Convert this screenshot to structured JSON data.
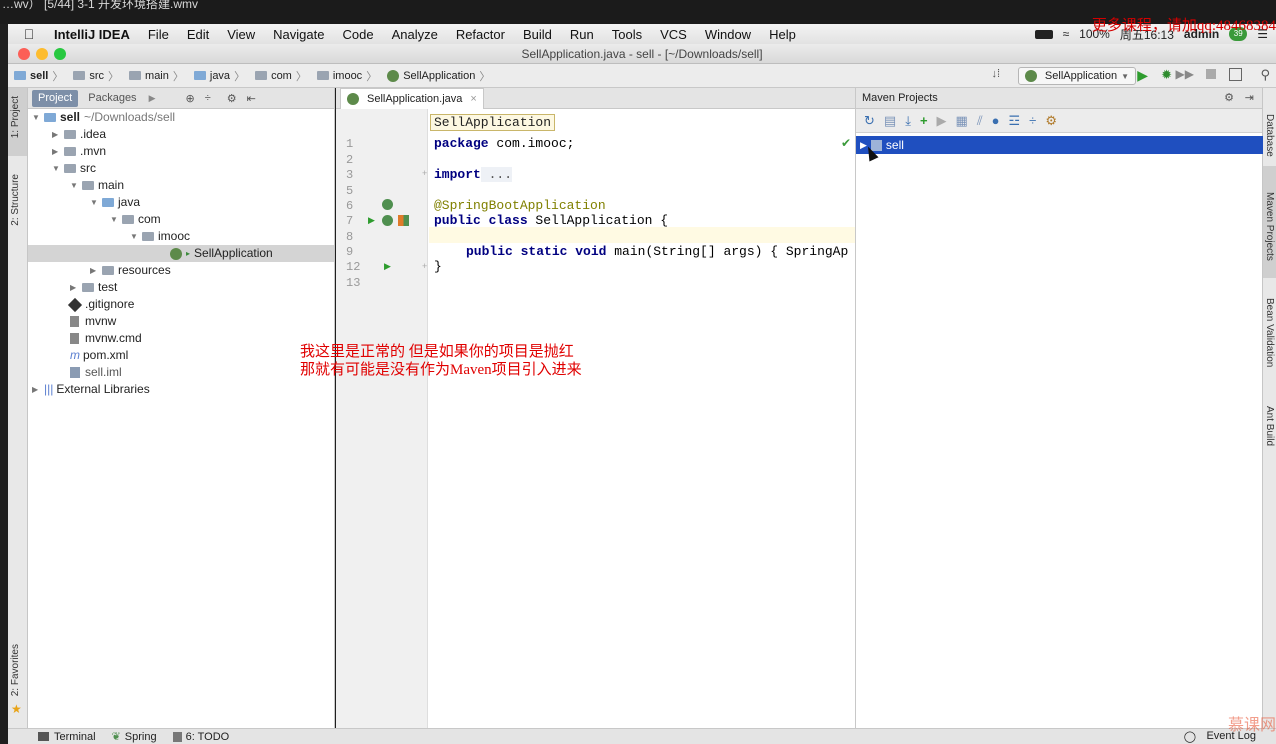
{
  "video": {
    "title": "…wv）  [5/44] 3-1 开发环境搭建.wmv"
  },
  "menubar": {
    "app_name": "IntelliJ IDEA",
    "items": [
      "File",
      "Edit",
      "View",
      "Navigate",
      "Code",
      "Analyze",
      "Refactor",
      "Build",
      "Run",
      "Tools",
      "VCS",
      "Window",
      "Help"
    ],
    "battery": "100%",
    "clock": "周五16:13",
    "user": "admin",
    "badge": "39"
  },
  "promo_text": "更多课程，请加qq:48468384",
  "window": {
    "title": "SellApplication.java - sell - [~/Downloads/sell]"
  },
  "breadcrumbs": [
    "sell",
    "src",
    "main",
    "java",
    "com",
    "imooc",
    "SellApplication"
  ],
  "run_config": "SellApplication",
  "left_strip": {
    "project": "1: Project",
    "structure": "2: Structure",
    "favorites": "2: Favorites"
  },
  "right_strip": {
    "database": "Database",
    "maven": "Maven Projects",
    "bean": "Bean Validation",
    "ant": "Ant Build"
  },
  "project_panel": {
    "tabs": [
      "Project",
      "Packages"
    ],
    "tree": [
      {
        "label": "sell",
        "suffix": "~/Downloads/sell"
      },
      {
        "label": ".idea"
      },
      {
        "label": ".mvn"
      },
      {
        "label": "src"
      },
      {
        "label": "main"
      },
      {
        "label": "java"
      },
      {
        "label": "com"
      },
      {
        "label": "imooc"
      },
      {
        "label": "SellApplication"
      },
      {
        "label": "resources"
      },
      {
        "label": "test"
      },
      {
        "label": ".gitignore"
      },
      {
        "label": "mvnw"
      },
      {
        "label": "mvnw.cmd"
      },
      {
        "label": "pom.xml"
      },
      {
        "label": "sell.iml"
      },
      {
        "label": "External Libraries"
      }
    ]
  },
  "editor": {
    "tab": "SellApplication.java",
    "hint": "SellApplication",
    "line_numbers": [
      "1",
      "2",
      "3",
      "5",
      "6",
      "7",
      "8",
      "9",
      "12",
      "13"
    ],
    "lines": {
      "l1_kw": "package",
      "l1_rest": " com.imooc;",
      "l3_kw": "import",
      "l3_rest": " ...",
      "l6": "@SpringBootApplication",
      "l7_kw": "public class",
      "l7_rest": " SellApplication {",
      "l9_kw": "public static void",
      "l9_rest": " main(String[] args) { SpringAp",
      "l12": "}"
    }
  },
  "maven_panel": {
    "title": "Maven Projects",
    "project": "sell"
  },
  "overlay_text": {
    "line1": "我这里是正常的 但是如果你的项目是抛红",
    "line2": "那就有可能是没有作为Maven项目引入进来"
  },
  "bottom_bar": {
    "terminal": "Terminal",
    "spring": "Spring",
    "todo": "6: TODO",
    "event_log": "Event Log",
    "watermark": "慕课网"
  }
}
